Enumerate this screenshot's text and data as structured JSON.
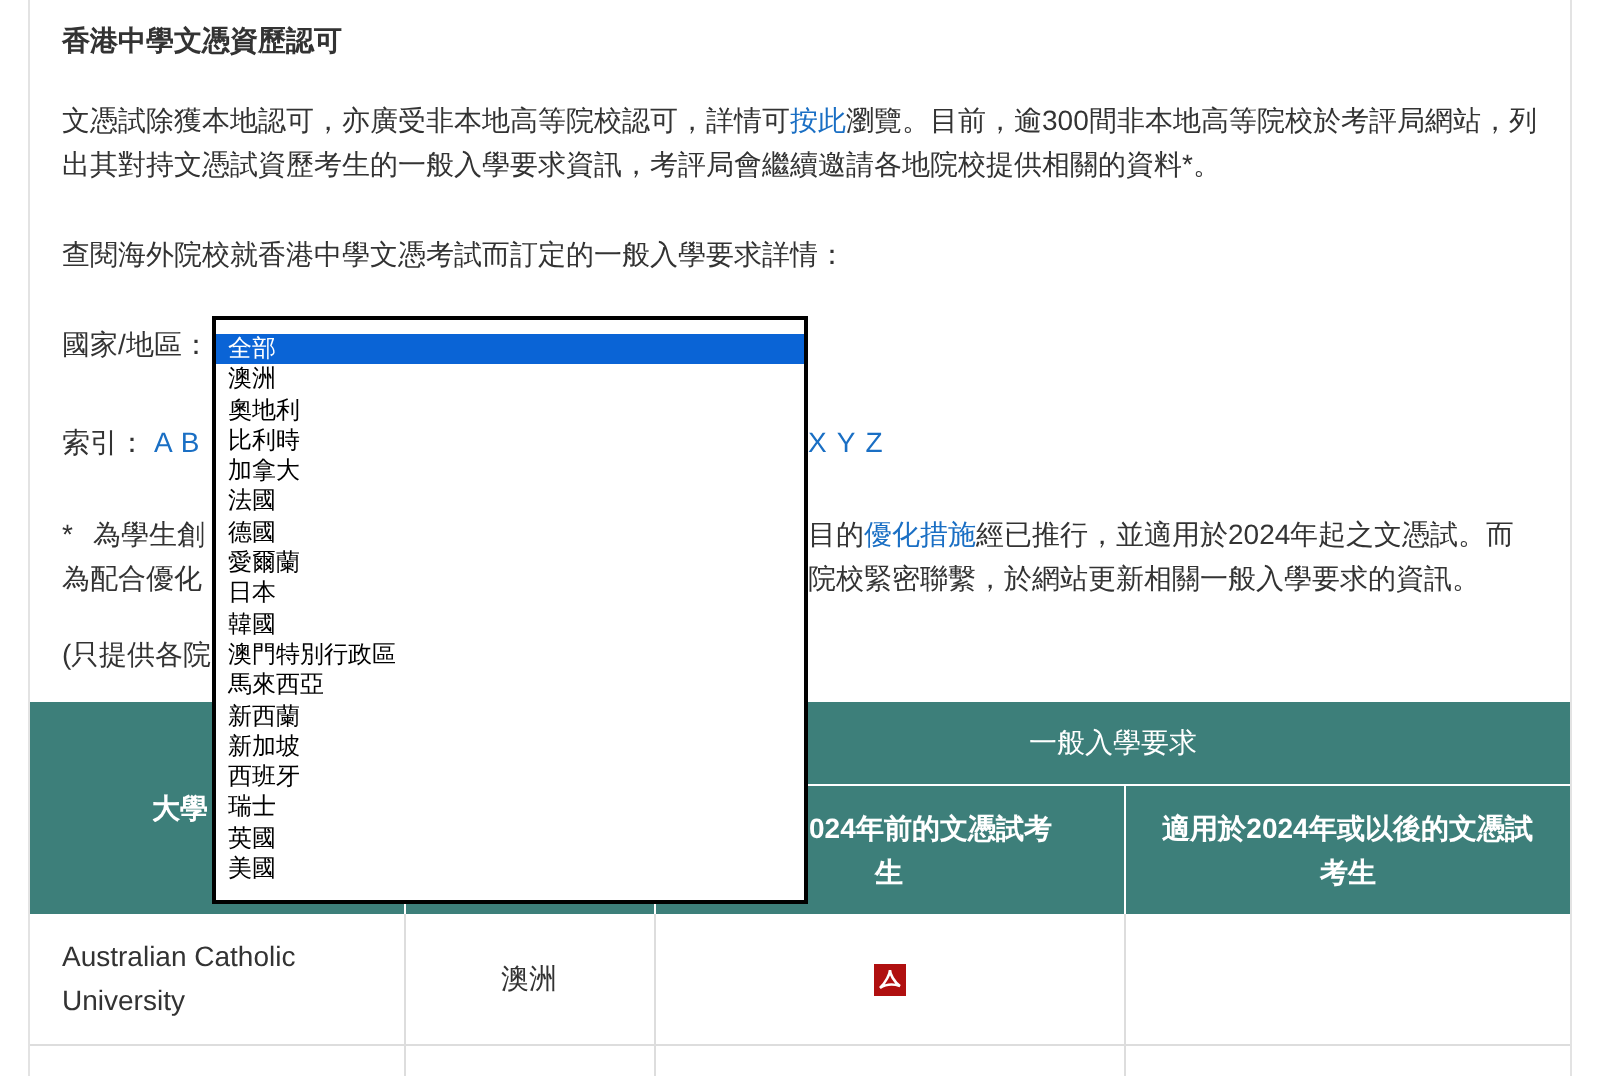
{
  "title": "香港中學文憑資歷認可",
  "paragraph": {
    "before": "文憑試除獲本地認可，亦廣受非本地高等院校認可，詳情可",
    "link": "按此",
    "after": "瀏覽。目前，逾300間非本地高等院校於考評局網站，列出其對持文憑試資歷考生的一般入學要求資訊，考評局會繼續邀請各地院校提供相關的資料*。"
  },
  "intro": "查閱海外院校就香港中學文憑考試而訂定的一般入學要求詳情：",
  "country_filter": {
    "label": "國家/地區：",
    "options": [
      {
        "label": "全部",
        "selected": true
      },
      {
        "label": "澳洲",
        "selected": false
      },
      {
        "label": "奧地利",
        "selected": false
      },
      {
        "label": "比利時",
        "selected": false
      },
      {
        "label": "加拿大",
        "selected": false
      },
      {
        "label": "法國",
        "selected": false
      },
      {
        "label": "德國",
        "selected": false
      },
      {
        "label": "愛爾蘭",
        "selected": false
      },
      {
        "label": "日本",
        "selected": false
      },
      {
        "label": "韓國",
        "selected": false
      },
      {
        "label": "澳門特別行政區",
        "selected": false
      },
      {
        "label": "馬來西亞",
        "selected": false
      },
      {
        "label": "新西蘭",
        "selected": false
      },
      {
        "label": "新加坡",
        "selected": false
      },
      {
        "label": "西班牙",
        "selected": false
      },
      {
        "label": "瑞士",
        "selected": false
      },
      {
        "label": "英國",
        "selected": false
      },
      {
        "label": "美國",
        "selected": false
      }
    ]
  },
  "index": {
    "label": "索引：",
    "letters_left": [
      "A",
      "B"
    ],
    "letters_right": [
      "X",
      "Y",
      "Z"
    ]
  },
  "footnote": {
    "mark": "*",
    "line1_left": "為學生創",
    "line1_before": "目的",
    "line1_link": "優化措施",
    "line1_after": "經已推行，並適用於2024年起之文憑試。而",
    "line2_left": "為配合優化",
    "line2_right": "院校緊密聯繫，於網站更新相關一般入學要求的資訊。"
  },
  "note_left": "(只提供各院",
  "table": {
    "header_university": "大學",
    "header_requirements": "一般入學要求",
    "header_before": [
      "024年前的文憑試考",
      "生"
    ],
    "header_after": "適用於2024年或以後的文憑試考生",
    "rows": [
      {
        "university": "Australian Catholic University",
        "country": "澳洲",
        "before_document": true
      }
    ]
  }
}
